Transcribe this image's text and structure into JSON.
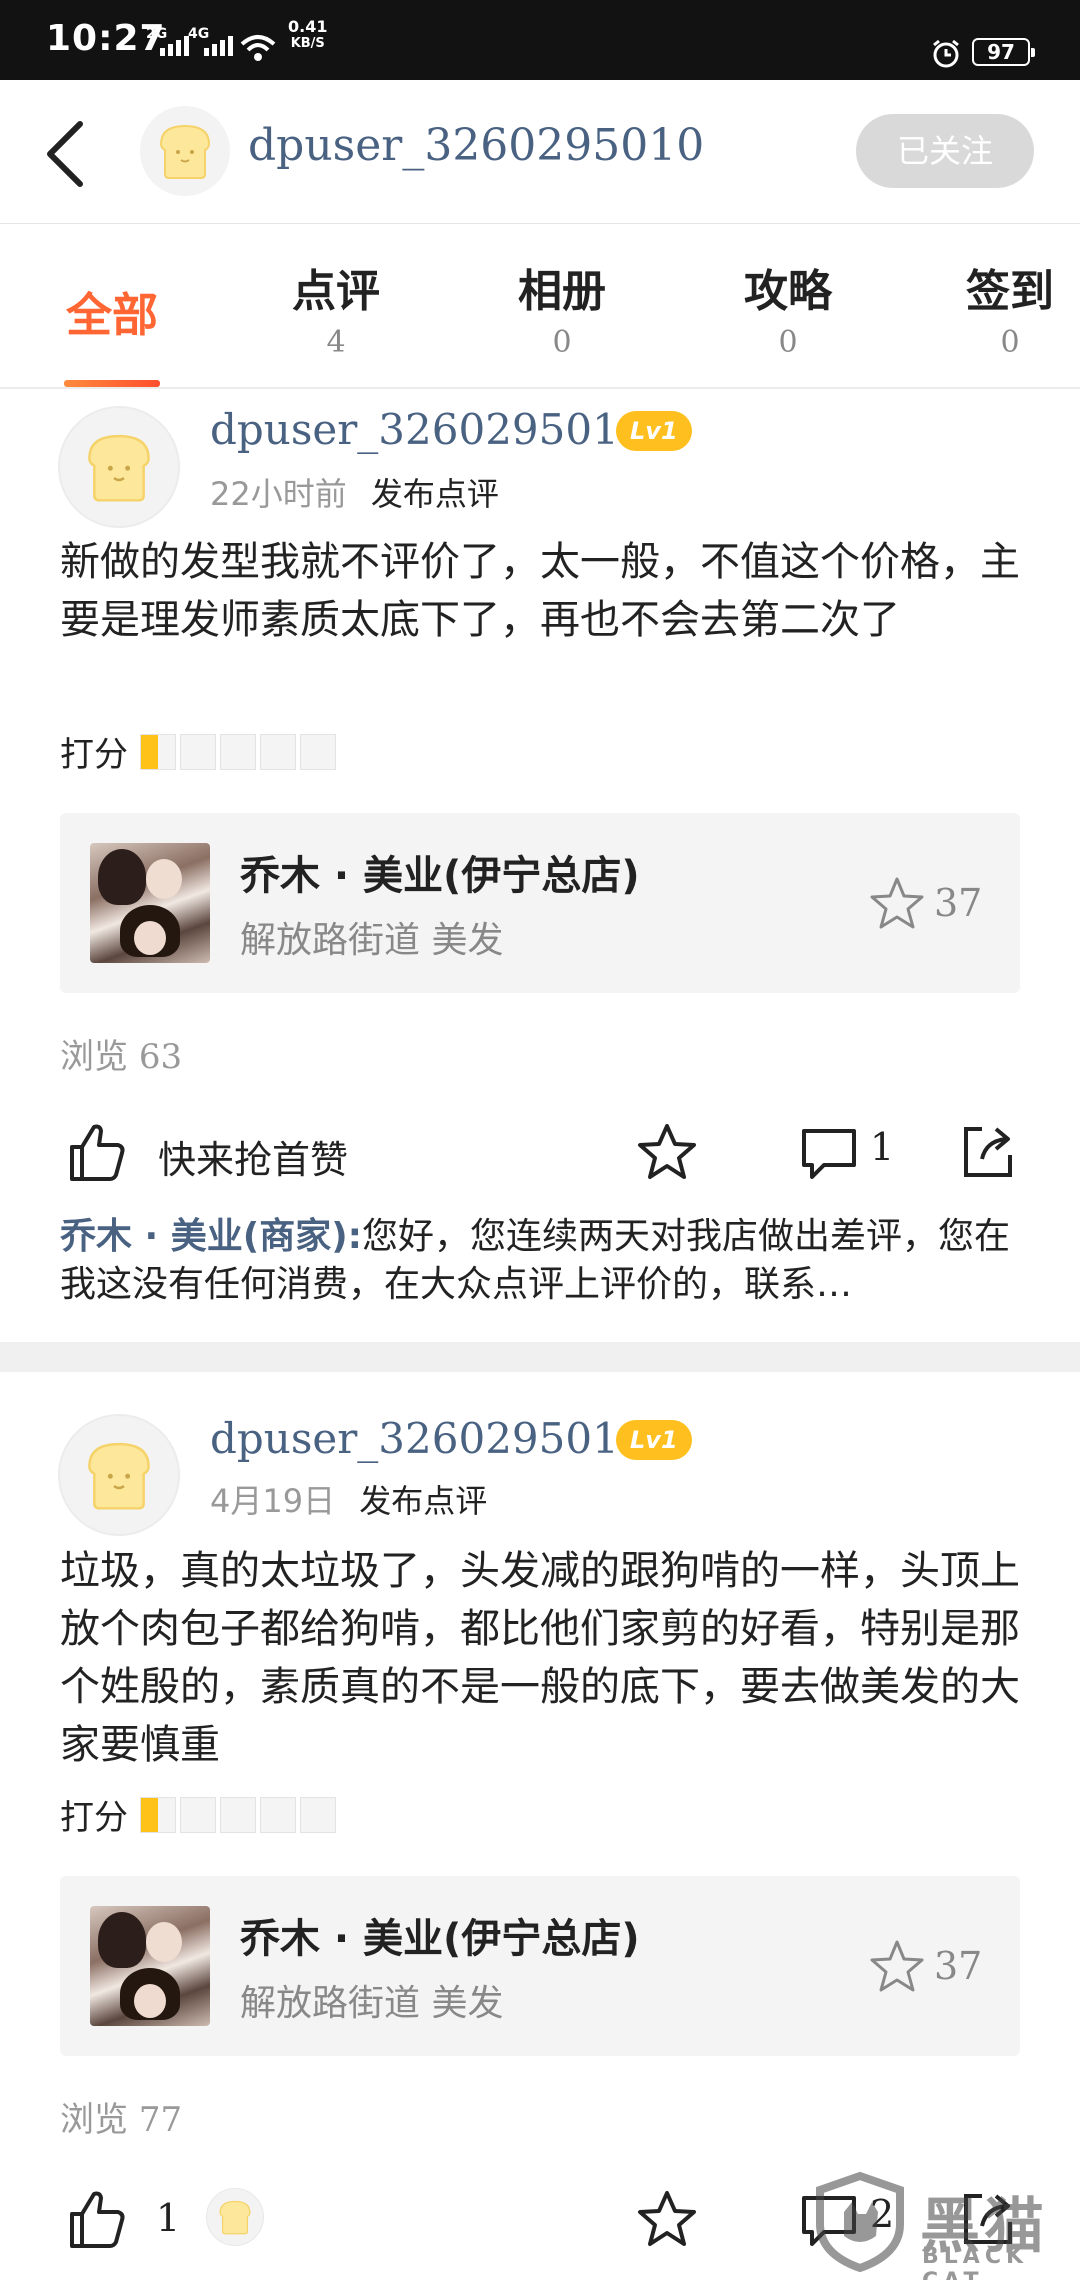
{
  "status_bar": {
    "time": "10:27",
    "sig1": "2G",
    "sig2": "4G",
    "net_speed": "0.41",
    "net_unit": "KB/S",
    "battery": "97"
  },
  "header": {
    "username": "dpuser_3260295010",
    "follow_label": "已关注"
  },
  "tabs": [
    {
      "label": "全部",
      "count": ""
    },
    {
      "label": "点评",
      "count": "4"
    },
    {
      "label": "相册",
      "count": "0"
    },
    {
      "label": "攻略",
      "count": "0"
    },
    {
      "label": "签到",
      "count": "0"
    }
  ],
  "colors": {
    "accent": "#ff6633",
    "link": "#4a6282",
    "level_badge": "#ffbf1f",
    "star_fill": "#ffc219"
  },
  "reviews": [
    {
      "username": "dpuser_3260295010",
      "level": "Lv1",
      "time": "22小时前",
      "action": "发布点评",
      "content": "新做的发型我就不评价了，太一般，不值这个价格，主要是理发师素质太底下了，再也不会去第二次了",
      "score_label": "打分",
      "rating": 0.5,
      "shop": {
        "name": "乔木 · 美业(伊宁总店)",
        "sub": "解放路街道 美发",
        "fav_count": "37"
      },
      "views_label": "浏览",
      "views": "63",
      "like_label": "快来抢首赞",
      "comment_count": "1",
      "reply_author": "乔木 · 美业(商家):",
      "reply_text": "您好，您连续两天对我店做出差评，您在我这没有任何消费，在大众点评上评价的，联系…"
    },
    {
      "username": "dpuser_3260295010",
      "level": "Lv1",
      "time": "4月19日",
      "action": "发布点评",
      "content": "垃圾，真的太垃圾了，头发减的跟狗啃的一样，头顶上放个肉包子都给狗啃，都比他们家剪的好看，特别是那个姓殷的，素质真的不是一般的底下，要去做美发的大家要慎重",
      "score_label": "打分",
      "rating": 0.5,
      "shop": {
        "name": "乔木 · 美业(伊宁总店)",
        "sub": "解放路街道 美发",
        "fav_count": "37"
      },
      "views_label": "浏览",
      "views": "77",
      "like_count": "1",
      "comment_count": "2"
    }
  ],
  "watermark": {
    "cn": "黑猫",
    "en": "BLACK CAT"
  }
}
